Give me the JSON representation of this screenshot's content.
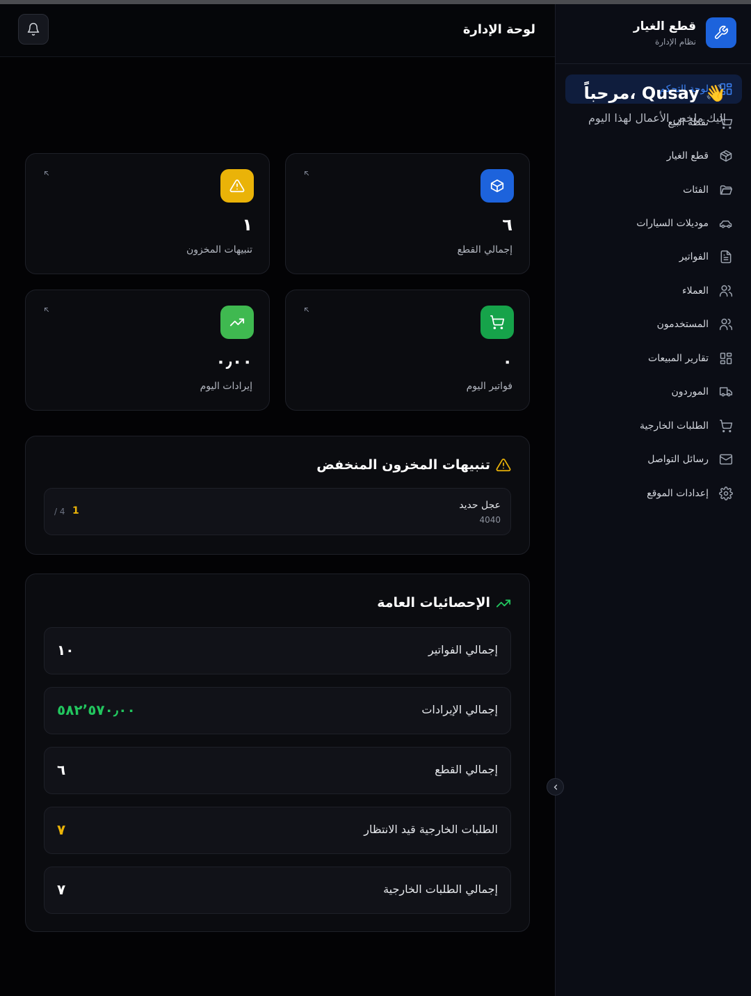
{
  "brand": {
    "title": "قطع الغيار",
    "subtitle": "نظام الإدارة",
    "icon": "wrench-icon"
  },
  "header": {
    "title": "لوحة الإدارة",
    "bell_icon": "bell-icon"
  },
  "sidebar": {
    "items": [
      {
        "label": "لوحة التحكم",
        "icon": "grid-icon",
        "active": true
      },
      {
        "label": "نقطة البيع",
        "icon": "cart-icon"
      },
      {
        "label": "قطع الغيار",
        "icon": "box-icon"
      },
      {
        "label": "الفئات",
        "icon": "folder-icon"
      },
      {
        "label": "موديلات السيارات",
        "icon": "car-icon"
      },
      {
        "label": "الفواتير",
        "icon": "document-icon"
      },
      {
        "label": "العملاء",
        "icon": "users-icon"
      },
      {
        "label": "المستخدمون",
        "icon": "users-icon"
      },
      {
        "label": "تقارير المبيعات",
        "icon": "grid-icon"
      },
      {
        "label": "الموردون",
        "icon": "truck-icon"
      },
      {
        "label": "الطلبات الخارجية",
        "icon": "cart-icon"
      },
      {
        "label": "رسائل التواصل",
        "icon": "mail-icon"
      },
      {
        "label": "إعدادات الموقع",
        "icon": "gear-icon"
      }
    ]
  },
  "welcome": {
    "title": "مرحباً، Qusay 👋",
    "subtitle": "إليك ملخص الأعمال لهذا اليوم"
  },
  "cards": [
    {
      "value": "٦",
      "label": "إجمالي القطع",
      "icon": "box-icon",
      "color": "#1d63dc"
    },
    {
      "value": "١",
      "label": "تنبيهات المخزون",
      "icon": "warning-icon",
      "color": "#eab308"
    },
    {
      "value": "٠",
      "label": "فواتير اليوم",
      "icon": "cart-icon",
      "color": "#16a34a"
    },
    {
      "value": "٠٫٠٠",
      "label": "إيرادات اليوم",
      "icon": "trending-up-icon",
      "color": "#3fb950"
    }
  ],
  "low_stock": {
    "title": "تنبيهات المخزون المنخفض",
    "items": [
      {
        "name": "عجل حديد",
        "code": "4040",
        "qty": "1",
        "min": "/ 4"
      }
    ]
  },
  "stats": {
    "title": "الإحصائيات العامة",
    "rows": [
      {
        "label": "إجمالي الفواتير",
        "value": "١٠",
        "color": "#ffffff"
      },
      {
        "label": "إجمالي الإيرادات",
        "value": "٥٨٢٬٥٧٠٫٠٠",
        "color": "#22c55e"
      },
      {
        "label": "إجمالي القطع",
        "value": "٦",
        "color": "#ffffff"
      },
      {
        "label": "الطلبات الخارجية قيد الانتظار",
        "value": "٧",
        "color": "#eab308"
      },
      {
        "label": "إجمالي الطلبات الخارجية",
        "value": "٧",
        "color": "#ffffff"
      }
    ]
  }
}
